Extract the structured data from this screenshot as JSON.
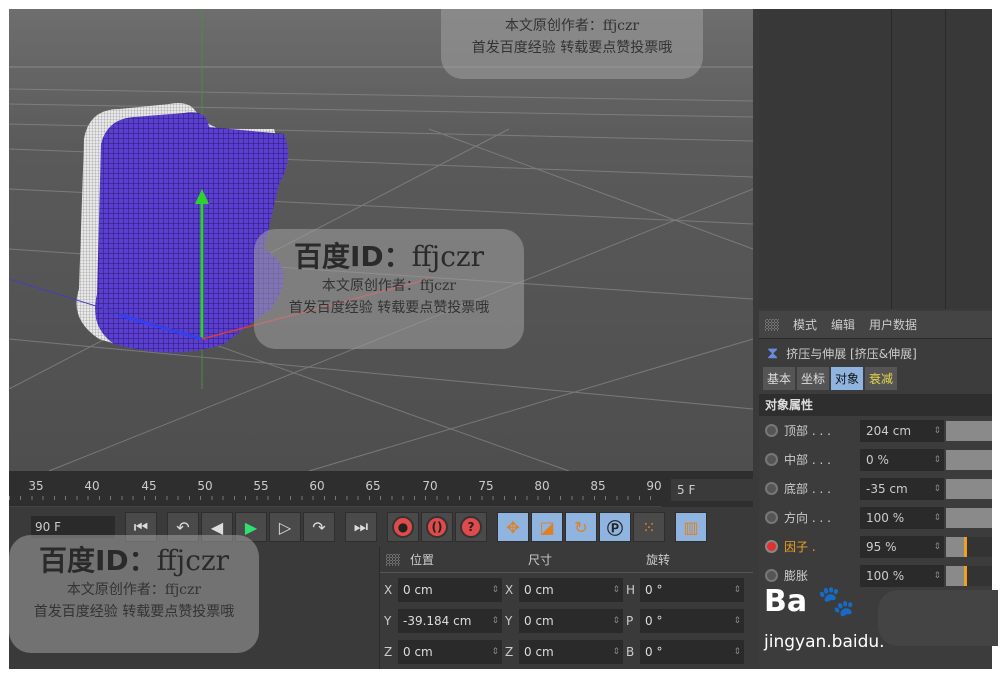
{
  "attributes": {
    "menu": [
      "模式",
      "编辑",
      "用户数据"
    ],
    "object_title": "挤压与伸展 [挤压&伸展]",
    "tabs": [
      {
        "label": "基本"
      },
      {
        "label": "坐标"
      },
      {
        "label": "对象",
        "active": true
      },
      {
        "label": "衰减"
      }
    ],
    "section": "对象属性",
    "rows": [
      {
        "label": "顶部 . . .",
        "value": "204 cm"
      },
      {
        "label": "中部 . . .",
        "value": "0 %"
      },
      {
        "label": "底部 . . .",
        "value": "-35 cm"
      },
      {
        "label": "方向 . . .",
        "value": "100 %"
      },
      {
        "label": "因子 .",
        "value": "95 %",
        "active": true,
        "slider": 0.95
      },
      {
        "label": "膨胀",
        "value": "100 %",
        "slider": 1.0
      }
    ]
  },
  "timeline": {
    "ticks": [
      "35",
      "40",
      "45",
      "50",
      "55",
      "60",
      "65",
      "70",
      "75",
      "80",
      "85",
      "90"
    ],
    "current_frame": "5 F",
    "end_frame": "90 F"
  },
  "coords": {
    "headers": [
      "位置",
      "尺寸",
      "旋转"
    ],
    "rows": [
      {
        "a": "X",
        "pos": "0 cm",
        "b": "X",
        "size": "0 cm",
        "c": "H",
        "rot": "0 °"
      },
      {
        "a": "Y",
        "pos": "-39.184 cm",
        "b": "Y",
        "size": "0 cm",
        "c": "P",
        "rot": "0 °"
      },
      {
        "a": "Z",
        "pos": "0 cm",
        "b": "Z",
        "size": "0 cm",
        "c": "B",
        "rot": "0 °"
      }
    ]
  },
  "watermark": {
    "id_label": "百度ID：",
    "id": "ffjczr",
    "author": "本文原创作者：ffjczr",
    "notice": "首发百度经验  转载要点赞投票哦",
    "logo": "Bai 经验",
    "logo_url": "jingyan.baidu."
  },
  "model_glyph": "度"
}
